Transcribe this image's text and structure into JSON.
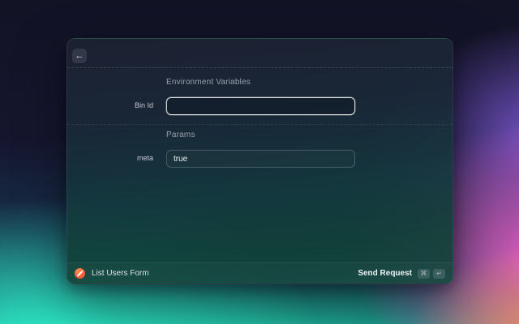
{
  "window": {
    "header": {
      "back_icon": "←"
    },
    "sections": [
      {
        "title": "Environment Variables",
        "rows": [
          {
            "label": "Bin Id",
            "value": "",
            "focused": true
          }
        ]
      },
      {
        "title": "Params",
        "rows": [
          {
            "label": "meta",
            "value": "true",
            "focused": false
          }
        ]
      }
    ],
    "footer": {
      "app_icon": "pencil-form-icon",
      "app_name": "List Users Form",
      "action_label": "Send Request",
      "shortcut_keys": [
        "⌘",
        "↵"
      ]
    }
  },
  "colors": {
    "accent_orange": "#f25a33",
    "teal": "#2ef5cd",
    "purple": "#7c58d2",
    "pink": "#ee5fc8",
    "focus_ring": "#ffffff"
  }
}
